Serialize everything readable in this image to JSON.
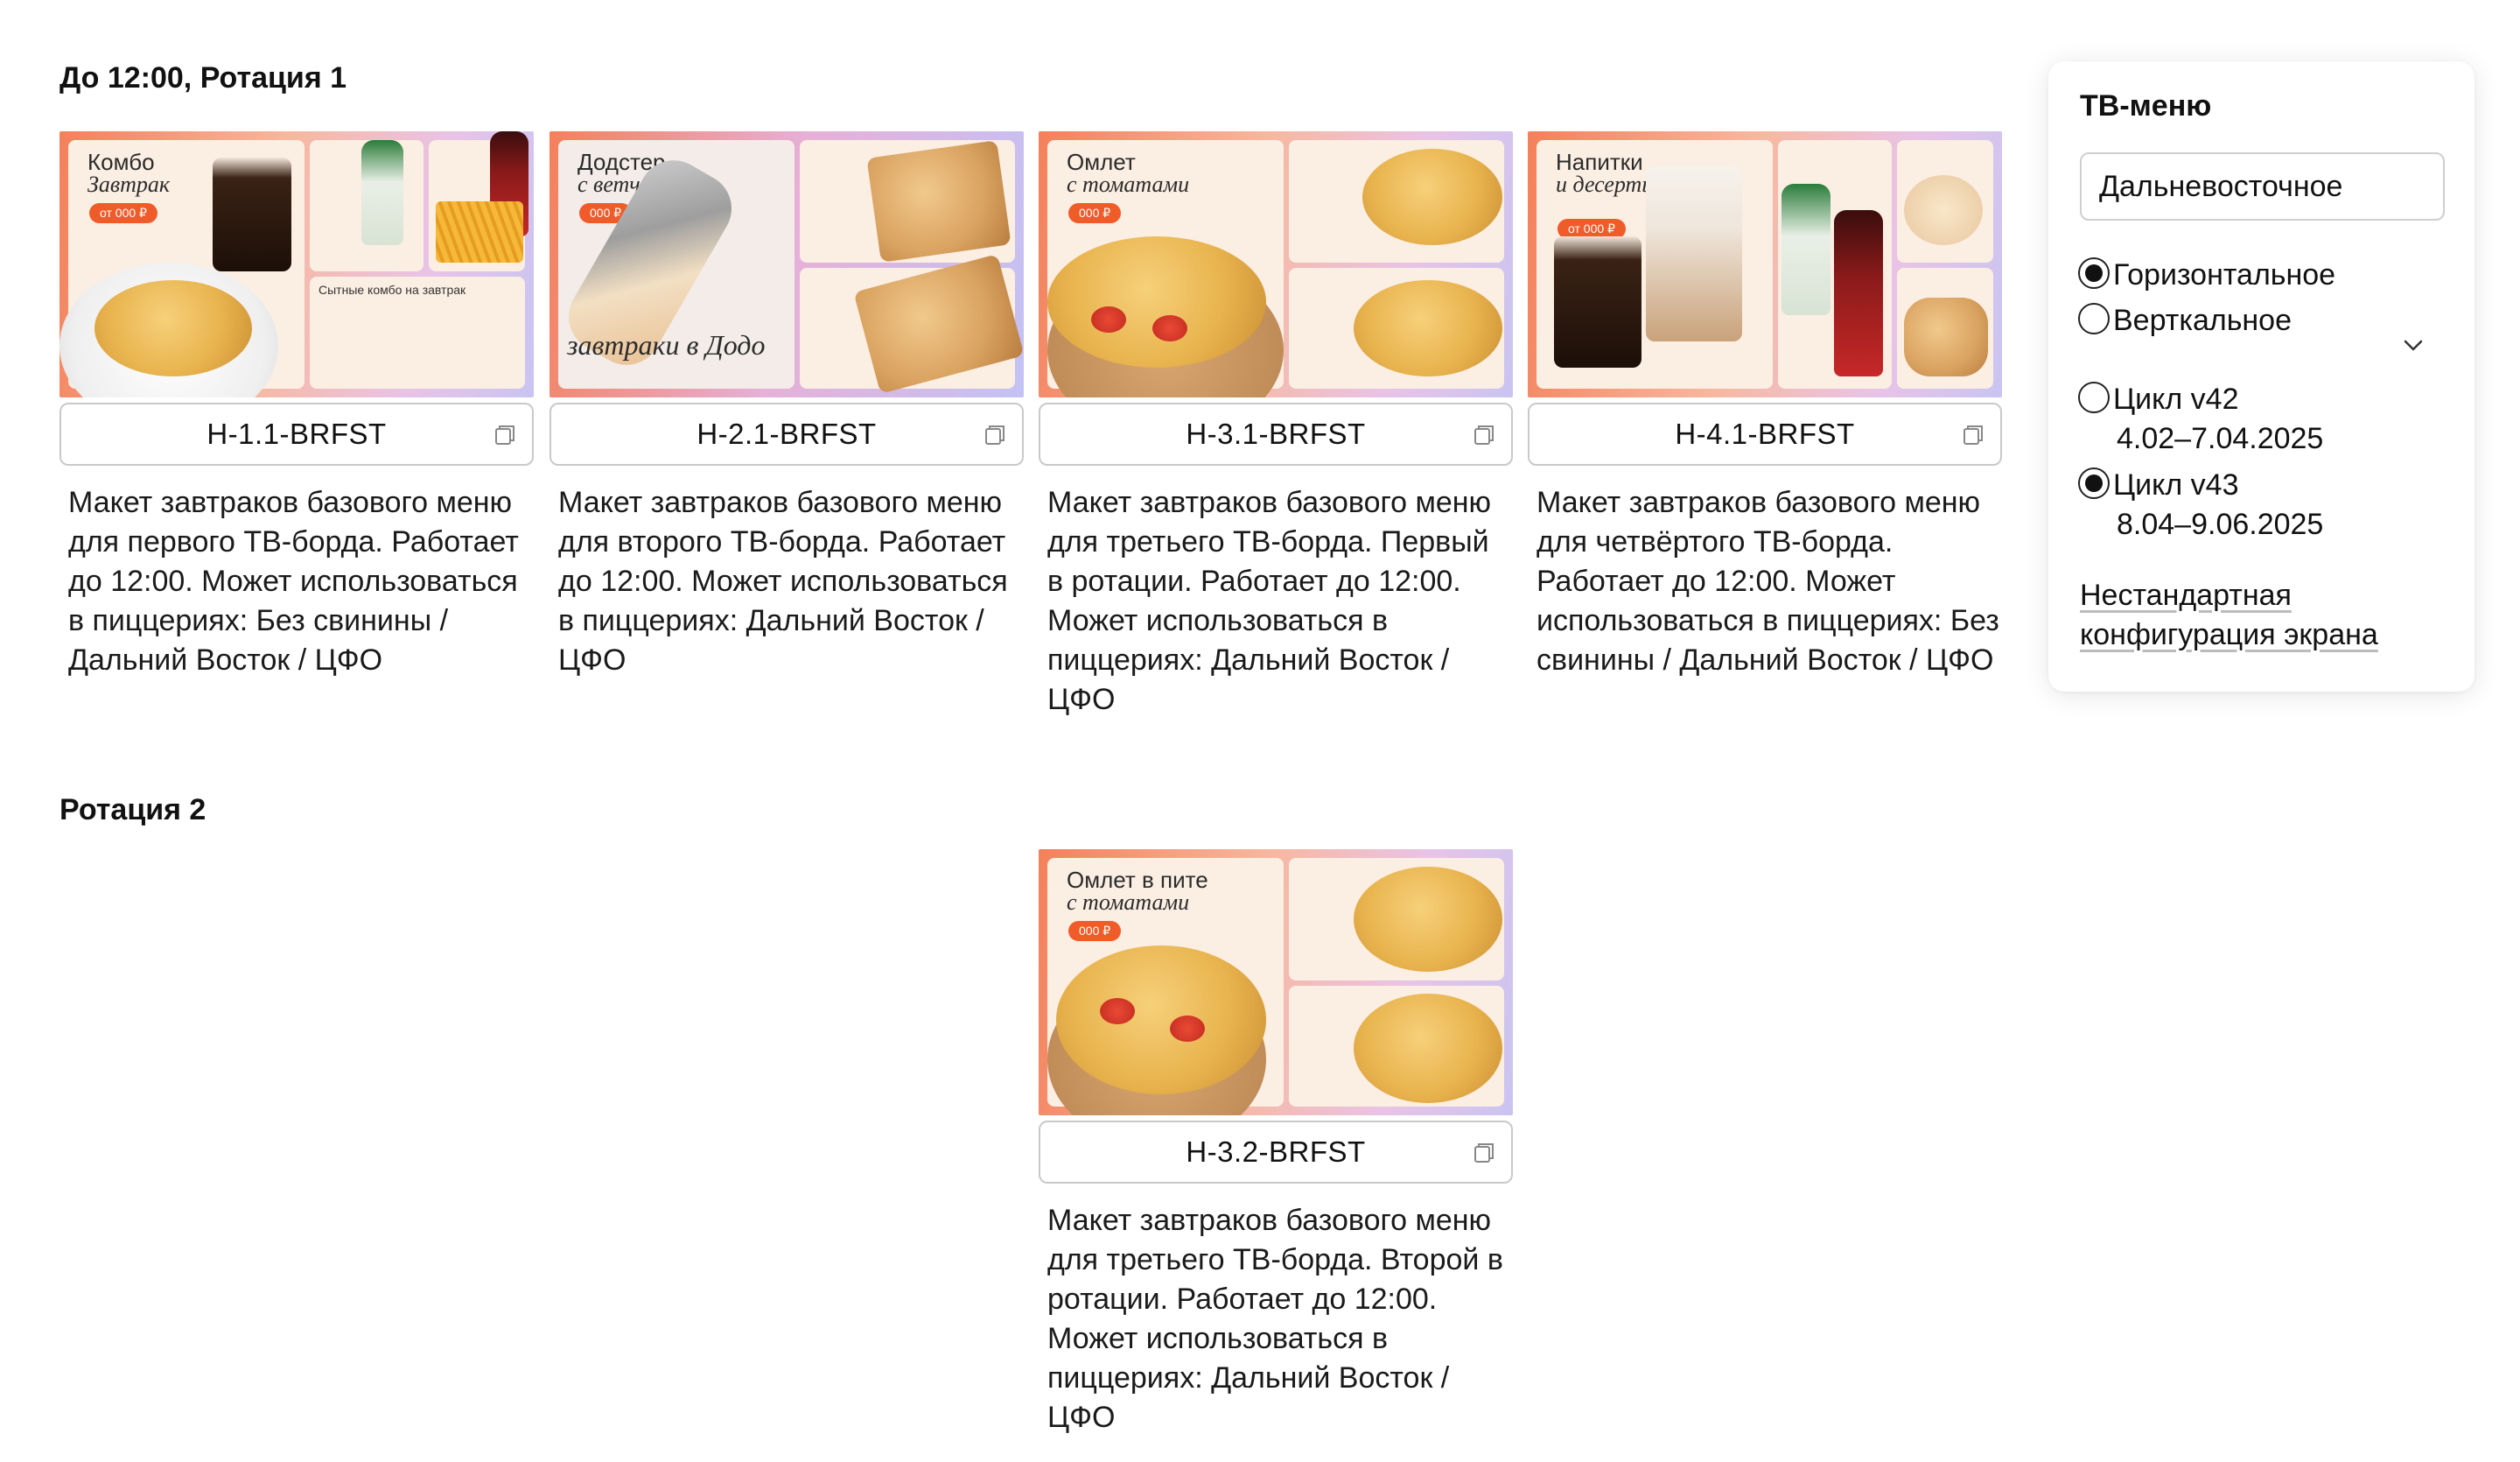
{
  "sections": {
    "rotation1_title": "До 12:00, Ротация 1",
    "rotation2_title": "Ротация 2"
  },
  "cards": [
    {
      "code": "H-1.1-BRFST",
      "description": "Макет завтраков базового меню для первого ТВ-борда. Работает до 12:00. Может использоваться в пиццериях: Без свинины / Дальний Восток / ЦФО",
      "thumb": {
        "title_line1": "Комбо",
        "title_line2": "Завтрак",
        "price": "от 000 ₽",
        "sub": "Сытные комбо на завтрак"
      }
    },
    {
      "code": "H-2.1-BRFST",
      "description": "Макет завтраков базового меню для второго ТВ-борда. Работает до 12:00. Может использоваться в пиццериях: Дальний Восток / ЦФО",
      "thumb": {
        "title_line1": "Додстер",
        "title_line2": "с ветчиной",
        "price": "000 ₽",
        "sub": "завтраки в Додо"
      }
    },
    {
      "code": "H-3.1-BRFST",
      "description": "Макет завтраков базового меню для третьего ТВ-борда. Первый в ротации. Работает до 12:00. Может использоваться в пиццериях: Дальний Восток / ЦФО",
      "thumb": {
        "title_line1": "Омлет",
        "title_line2": "с томатами",
        "price": "000 ₽",
        "sub": ""
      }
    },
    {
      "code": "H-4.1-BRFST",
      "description": "Макет завтраков базового меню для четвёртого ТВ-борда. Работает до 12:00. Может использоваться в пиццериях: Без свинины / Дальний Восток / ЦФО",
      "thumb": {
        "title_line1": "Напитки",
        "title_line2": "и десерты",
        "price": "от 000 ₽",
        "sub": ""
      }
    },
    {
      "code": "H-3.2-BRFST",
      "description": "Макет завтраков базового меню для третьего ТВ-борда. Второй в ротации. Работает до 12:00. Может использоваться в пиццериях: Дальний Восток / ЦФО",
      "thumb": {
        "title_line1": "Омлет в пите",
        "title_line2": "с томатами",
        "price": "000 ₽",
        "sub": ""
      }
    }
  ],
  "panel": {
    "title": "ТВ-меню",
    "region_value": "Дальневосточное",
    "orientation": {
      "horizontal_label": "Горизонтальное",
      "vertical_label": "Верткальное",
      "selected": "horizontal"
    },
    "cycles": [
      {
        "label": "Цикл v42",
        "dates": "4.02–7.04.2025",
        "selected": false
      },
      {
        "label": "Цикл v43",
        "dates": "8.04–9.06.2025",
        "selected": true
      }
    ],
    "custom_link_line1": "Нестандартная",
    "custom_link_line2": "конфигурация экрана"
  },
  "icons": {
    "copy": "copy-icon",
    "chevron": "chevron-down-icon"
  }
}
